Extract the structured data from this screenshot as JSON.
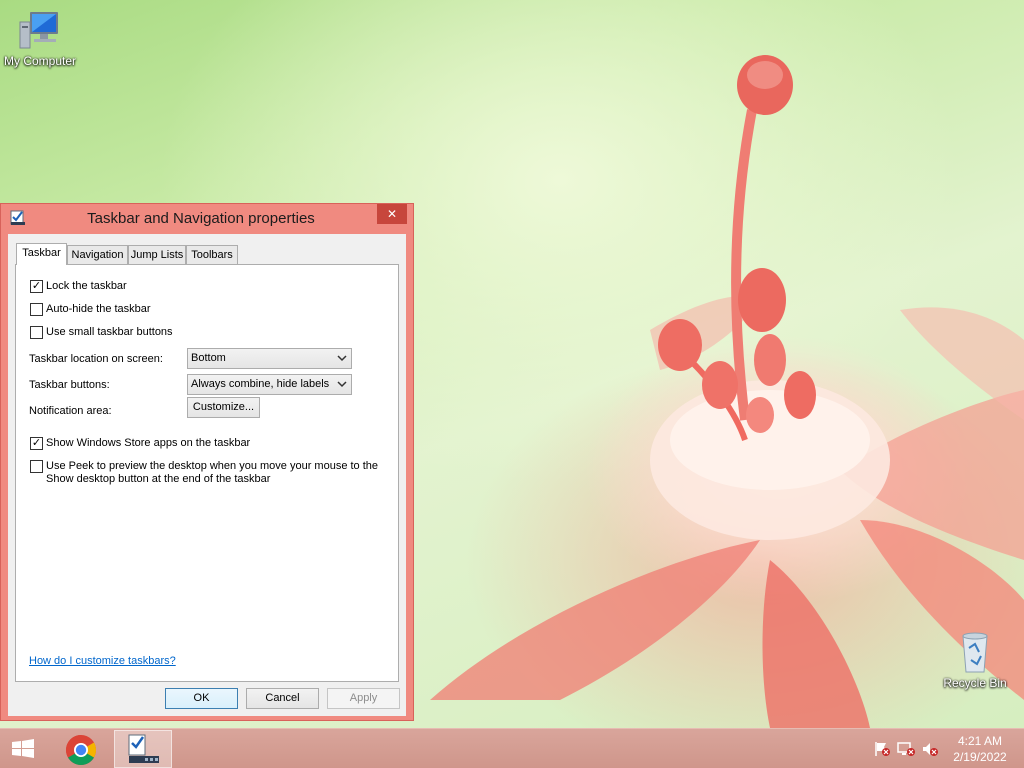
{
  "desktop": {
    "icons": [
      {
        "label": "My Computer",
        "icon": "computer-icon"
      },
      {
        "label": "Recycle Bin",
        "icon": "recycle-bin-icon"
      }
    ]
  },
  "dialog": {
    "title": "Taskbar and Navigation properties",
    "close_label": "✕",
    "tabs": [
      {
        "label": "Taskbar",
        "active": true
      },
      {
        "label": "Navigation",
        "active": false
      },
      {
        "label": "Jump Lists",
        "active": false
      },
      {
        "label": "Toolbars",
        "active": false
      }
    ],
    "checks": {
      "lock": {
        "label": "Lock the taskbar",
        "checked": true
      },
      "autohide": {
        "label": "Auto-hide the taskbar",
        "checked": false
      },
      "small": {
        "label": "Use small taskbar buttons",
        "checked": false
      },
      "store": {
        "label": "Show Windows Store apps on the taskbar",
        "checked": true
      },
      "peek": {
        "label": "Use Peek to preview the desktop when you move your mouse to the Show desktop button at the end of the taskbar",
        "checked": false
      }
    },
    "location": {
      "label": "Taskbar location on screen:",
      "value": "Bottom"
    },
    "buttons": {
      "label": "Taskbar buttons:",
      "value": "Always combine, hide labels"
    },
    "notification": {
      "label": "Notification area:",
      "button": "Customize..."
    },
    "help_link": "How do I customize taskbars?",
    "ok": "OK",
    "cancel": "Cancel",
    "apply": "Apply"
  },
  "taskbar": {
    "apps": [
      "start-icon",
      "chrome-icon",
      "taskbar-properties-icon"
    ],
    "tray": [
      "action-center-flag-icon",
      "network-icon",
      "volume-muted-icon"
    ],
    "time": "4:21 AM",
    "date": "2/19/2022"
  },
  "colors": {
    "window_frame": "#f08a80",
    "close_button": "#c7463c",
    "taskbar": "#d9a59b",
    "link": "#0066cc"
  }
}
